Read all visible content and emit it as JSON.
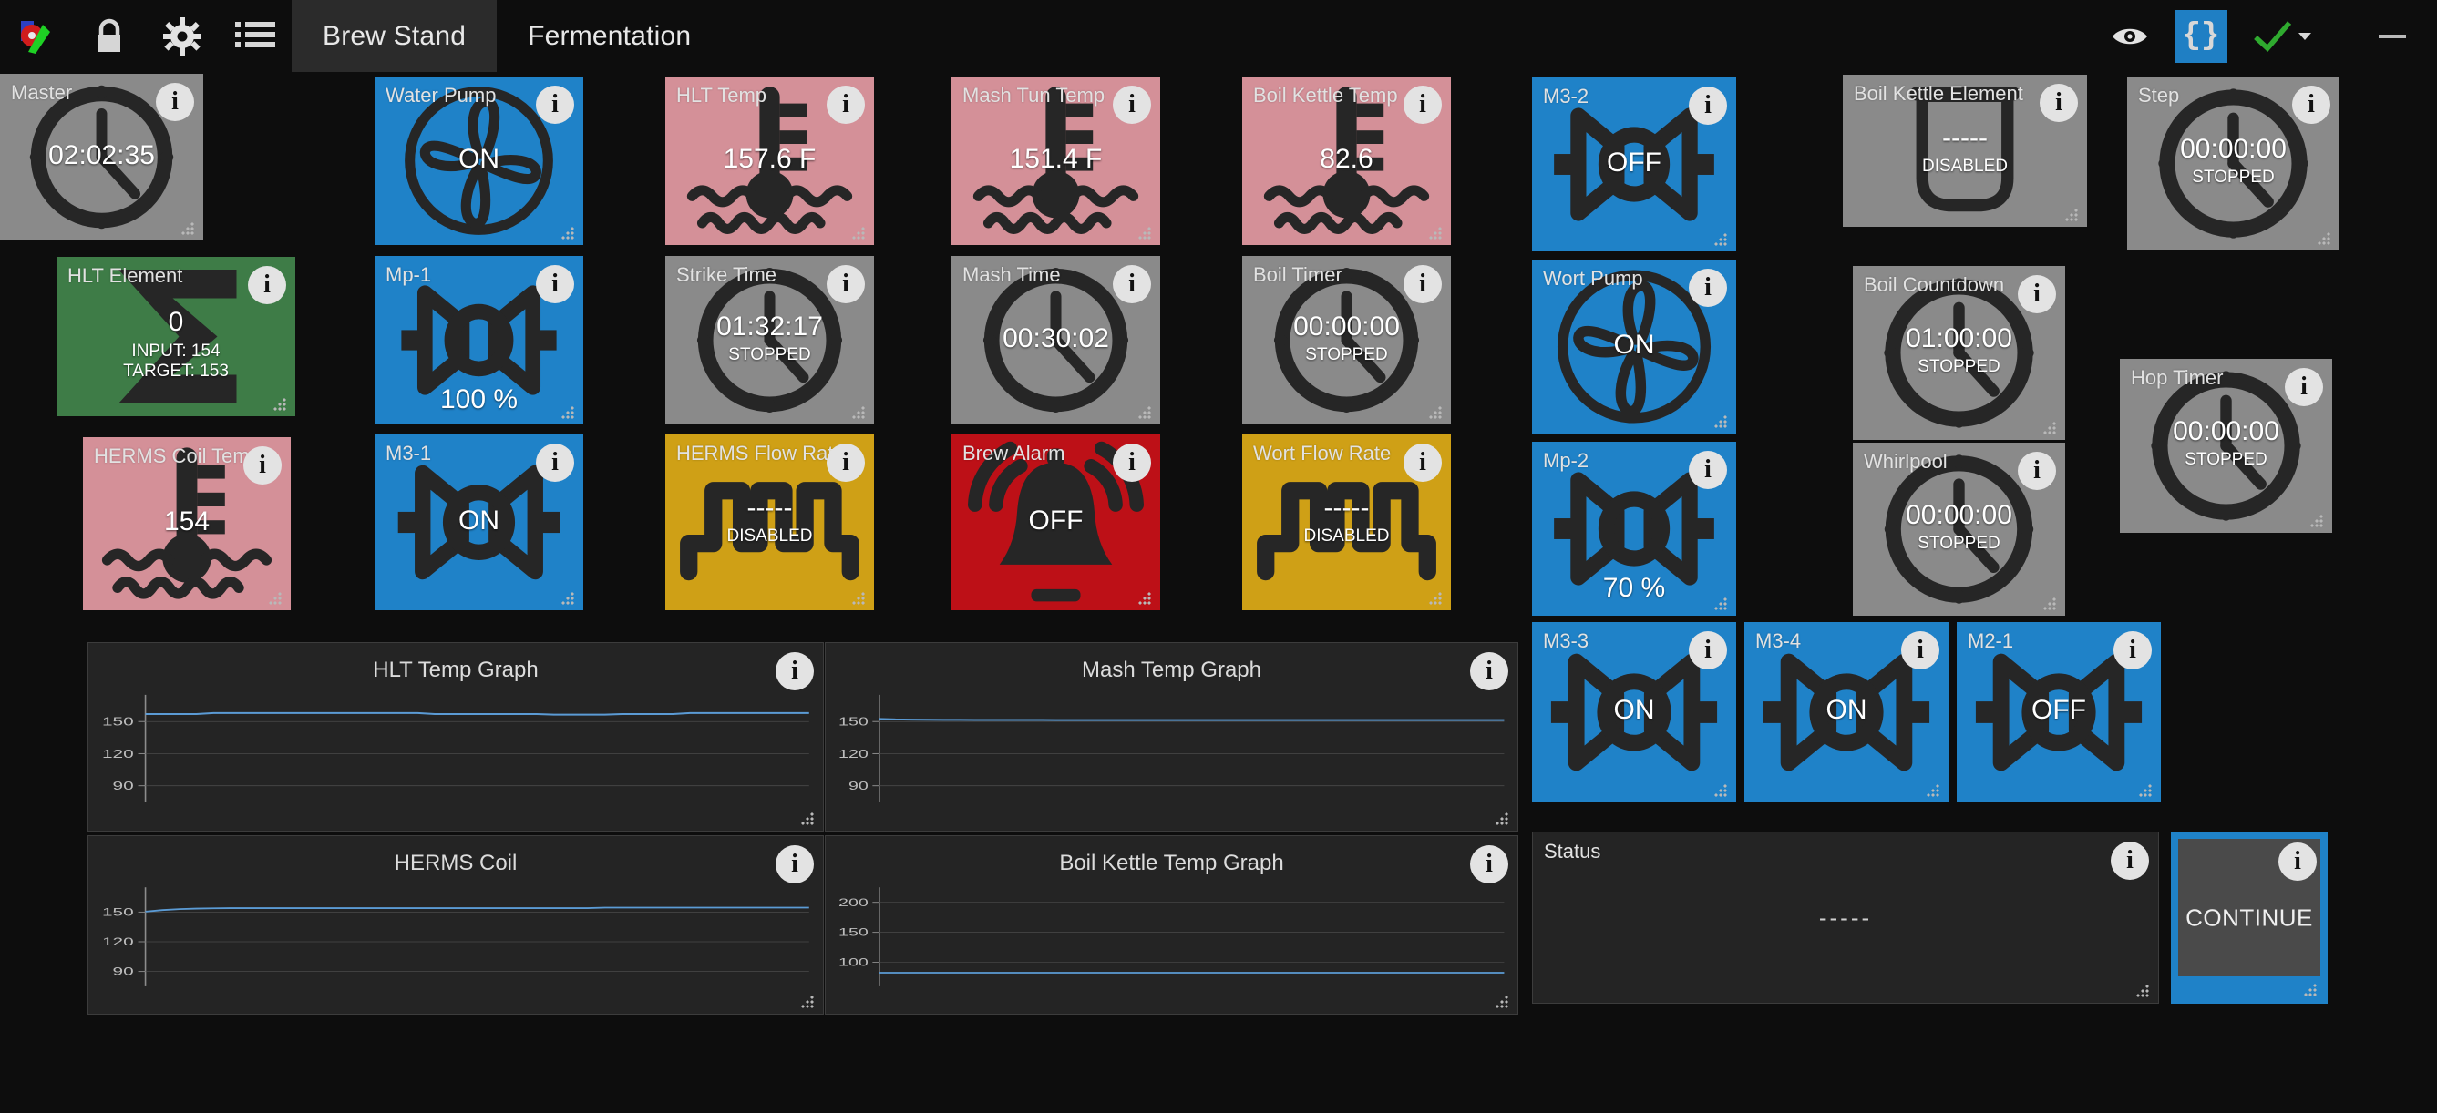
{
  "titlebar": {
    "icons": [
      {
        "name": "app-logo-icon",
        "label": "app-logo"
      },
      {
        "name": "lock-icon",
        "label": "lock"
      },
      {
        "name": "gear-icon",
        "label": "settings"
      },
      {
        "name": "list-icon",
        "label": "list"
      }
    ],
    "tabs": [
      {
        "label": "Brew Stand",
        "active": true
      },
      {
        "label": "Fermentation",
        "active": false
      }
    ],
    "right_icons": [
      {
        "name": "eye-icon",
        "label": "eye"
      },
      {
        "name": "json-braces-icon",
        "label": "{}"
      },
      {
        "name": "checkmark-icon",
        "label": "check"
      }
    ],
    "window_controls": {
      "minimize": "minimize-button"
    }
  },
  "widgets": [
    {
      "id": "master",
      "title": "Master",
      "kind": "clock",
      "value": "02:02:35",
      "sub": "",
      "color": "grey"
    },
    {
      "id": "hlt-element",
      "title": "HLT Element",
      "kind": "element",
      "value": "0",
      "sub": "INPUT: 154",
      "sub2": "TARGET: 153",
      "color": "green"
    },
    {
      "id": "herms-coil-temp",
      "title": "HERMS Coil Temp",
      "kind": "temp",
      "value": "154",
      "sub": "",
      "color": "red"
    },
    {
      "id": "water-pump",
      "title": "Water Pump",
      "kind": "pump",
      "value": "ON",
      "sub": "",
      "color": "blue"
    },
    {
      "id": "mp-1",
      "title": "Mp-1",
      "kind": "valve",
      "value": "",
      "sub": "100 %",
      "color": "blue"
    },
    {
      "id": "m3-1",
      "title": "M3-1",
      "kind": "valve",
      "value": "ON",
      "sub": "",
      "color": "blue"
    },
    {
      "id": "hlt-temp",
      "title": "HLT Temp",
      "kind": "temp",
      "value": "157.6 F",
      "sub": "",
      "color": "red"
    },
    {
      "id": "strike-time",
      "title": "Strike Time",
      "kind": "clock",
      "value": "01:32:17",
      "sub": "STOPPED",
      "color": "grey"
    },
    {
      "id": "herms-flow-rate",
      "title": "HERMS Flow Rate",
      "kind": "flow",
      "value": "-----",
      "sub": "DISABLED",
      "color": "gold"
    },
    {
      "id": "mash-tun-temp",
      "title": "Mash Tun Temp",
      "kind": "temp",
      "value": "151.4 F",
      "sub": "",
      "color": "red"
    },
    {
      "id": "mash-time",
      "title": "Mash Time",
      "kind": "clock",
      "value": "00:30:02",
      "sub": "",
      "color": "grey"
    },
    {
      "id": "brew-alarm",
      "title": "Brew Alarm",
      "kind": "alarm",
      "value": "OFF",
      "sub": "",
      "color": "alarm"
    },
    {
      "id": "boil-kettle-temp",
      "title": "Boil Kettle Temp",
      "kind": "temp",
      "value": "82.6",
      "sub": "",
      "color": "red"
    },
    {
      "id": "boil-timer",
      "title": "Boil Timer",
      "kind": "clock",
      "value": "00:00:00",
      "sub": "STOPPED",
      "color": "grey"
    },
    {
      "id": "wort-flow-rate",
      "title": "Wort Flow Rate",
      "kind": "flow",
      "value": "-----",
      "sub": "DISABLED",
      "color": "gold"
    },
    {
      "id": "m3-2",
      "title": "M3-2",
      "kind": "valve",
      "value": "OFF",
      "sub": "",
      "color": "blue"
    },
    {
      "id": "wort-pump",
      "title": "Wort Pump",
      "kind": "pump",
      "value": "ON",
      "sub": "",
      "color": "blue"
    },
    {
      "id": "mp-2",
      "title": "Mp-2",
      "kind": "valve",
      "value": "",
      "sub": "70 %",
      "color": "blue"
    },
    {
      "id": "m3-3",
      "title": "M3-3",
      "kind": "valve",
      "value": "ON",
      "sub": "",
      "color": "blue"
    },
    {
      "id": "m3-4",
      "title": "M3-4",
      "kind": "valve",
      "value": "ON",
      "sub": "",
      "color": "blue"
    },
    {
      "id": "m2-1",
      "title": "M2-1",
      "kind": "valve",
      "value": "OFF",
      "sub": "",
      "color": "blue"
    },
    {
      "id": "boil-kettle-element",
      "title": "Boil Kettle Element",
      "kind": "kettle",
      "value": "-----",
      "sub": "DISABLED",
      "color": "grey"
    },
    {
      "id": "boil-countdown",
      "title": "Boil Countdown",
      "kind": "clock",
      "value": "01:00:00",
      "sub": "STOPPED",
      "color": "grey"
    },
    {
      "id": "whirlpool",
      "title": "Whirlpool",
      "kind": "clock",
      "value": "00:00:00",
      "sub": "STOPPED",
      "color": "grey"
    },
    {
      "id": "step",
      "title": "Step",
      "kind": "clock",
      "value": "00:00:00",
      "sub": "STOPPED",
      "color": "grey"
    },
    {
      "id": "hop-timer",
      "title": "Hop Timer",
      "kind": "clock",
      "value": "00:00:00",
      "sub": "STOPPED",
      "color": "grey"
    }
  ],
  "status_panel": {
    "title": "Status",
    "value": "-----"
  },
  "continue_button": {
    "label": "CONTINUE"
  },
  "chart_data": [
    {
      "id": "hlt-temp-graph",
      "type": "line",
      "title": "HLT Temp Graph",
      "xlabel": "",
      "ylabel": "",
      "yticks": [
        150,
        120,
        90
      ],
      "ylim": [
        75,
        175
      ],
      "grid": true,
      "legend": null,
      "series": [
        {
          "name": "HLT Temp",
          "color": "#5b9bd5",
          "values": [
            157.0,
            157.0,
            157.0,
            157.0,
            158.0,
            158.0,
            158.0,
            158.0,
            158.0,
            158.0,
            158.0,
            158.0,
            158.0,
            158.0,
            158.0,
            158.0,
            158.0,
            157.0,
            157.0,
            157.0,
            157.0,
            157.0,
            157.0,
            157.0,
            156.5,
            156.5,
            156.5,
            156.5,
            157.0,
            157.0,
            157.0,
            157.0,
            158.0,
            158.0,
            158.0,
            158.0,
            158.0,
            158.0,
            158.0,
            158.0
          ]
        }
      ]
    },
    {
      "id": "mash-temp-graph",
      "type": "line",
      "title": "Mash Temp Graph",
      "xlabel": "",
      "ylabel": "",
      "yticks": [
        150,
        120,
        90
      ],
      "ylim": [
        75,
        175
      ],
      "grid": true,
      "legend": null,
      "series": [
        {
          "name": "Mash Temp",
          "color": "#5b9bd5",
          "values": [
            152.5,
            152.0,
            151.8,
            151.7,
            151.6,
            151.6,
            151.5,
            151.5,
            151.5,
            151.5,
            151.5,
            151.4,
            151.4,
            151.4,
            151.4,
            151.4,
            151.4,
            151.4,
            151.4,
            151.4,
            151.4,
            151.4,
            151.4,
            151.4,
            151.4,
            151.4,
            151.4,
            151.4,
            151.4,
            151.4,
            151.4,
            151.4,
            151.4,
            151.4,
            151.4,
            151.4,
            151.4,
            151.4,
            151.4,
            151.4
          ]
        }
      ]
    },
    {
      "id": "herms-coil-graph",
      "type": "line",
      "title": "HERMS Coil",
      "xlabel": "",
      "ylabel": "",
      "yticks": [
        150,
        120,
        90
      ],
      "ylim": [
        75,
        175
      ],
      "grid": true,
      "legend": null,
      "series": [
        {
          "name": "HERMS Coil",
          "color": "#5b9bd5",
          "values": [
            150.5,
            152.0,
            153.0,
            153.5,
            153.8,
            154.0,
            154.0,
            154.0,
            154.0,
            154.0,
            154.0,
            154.0,
            154.0,
            154.0,
            154.0,
            154.0,
            154.0,
            154.0,
            154.0,
            154.0,
            154.0,
            154.0,
            154.0,
            154.0,
            154.0,
            154.0,
            154.0,
            154.5,
            154.5,
            154.5,
            154.5,
            154.5,
            154.5,
            154.5,
            154.5,
            154.5,
            154.5,
            154.5,
            154.5,
            154.5
          ]
        }
      ]
    },
    {
      "id": "boil-kettle-temp-graph",
      "type": "line",
      "title": "Boil Kettle Temp Graph",
      "xlabel": "",
      "ylabel": "",
      "yticks": [
        200,
        150,
        100
      ],
      "ylim": [
        60,
        225
      ],
      "grid": true,
      "legend": null,
      "series": [
        {
          "name": "Boil Kettle Temp",
          "color": "#5b9bd5",
          "values": [
            82.6,
            82.6,
            82.6,
            82.6,
            82.6,
            82.6,
            82.6,
            82.6,
            82.6,
            82.6,
            82.6,
            82.6,
            82.6,
            82.6,
            82.6,
            82.6,
            82.6,
            82.6,
            82.6,
            82.6,
            82.6,
            82.6,
            82.6,
            82.6,
            82.6,
            82.6,
            82.6,
            82.6,
            82.6,
            82.6,
            82.6,
            82.6,
            82.6,
            82.6,
            82.6,
            82.6,
            82.6,
            82.6,
            82.6,
            82.6
          ]
        }
      ]
    }
  ]
}
